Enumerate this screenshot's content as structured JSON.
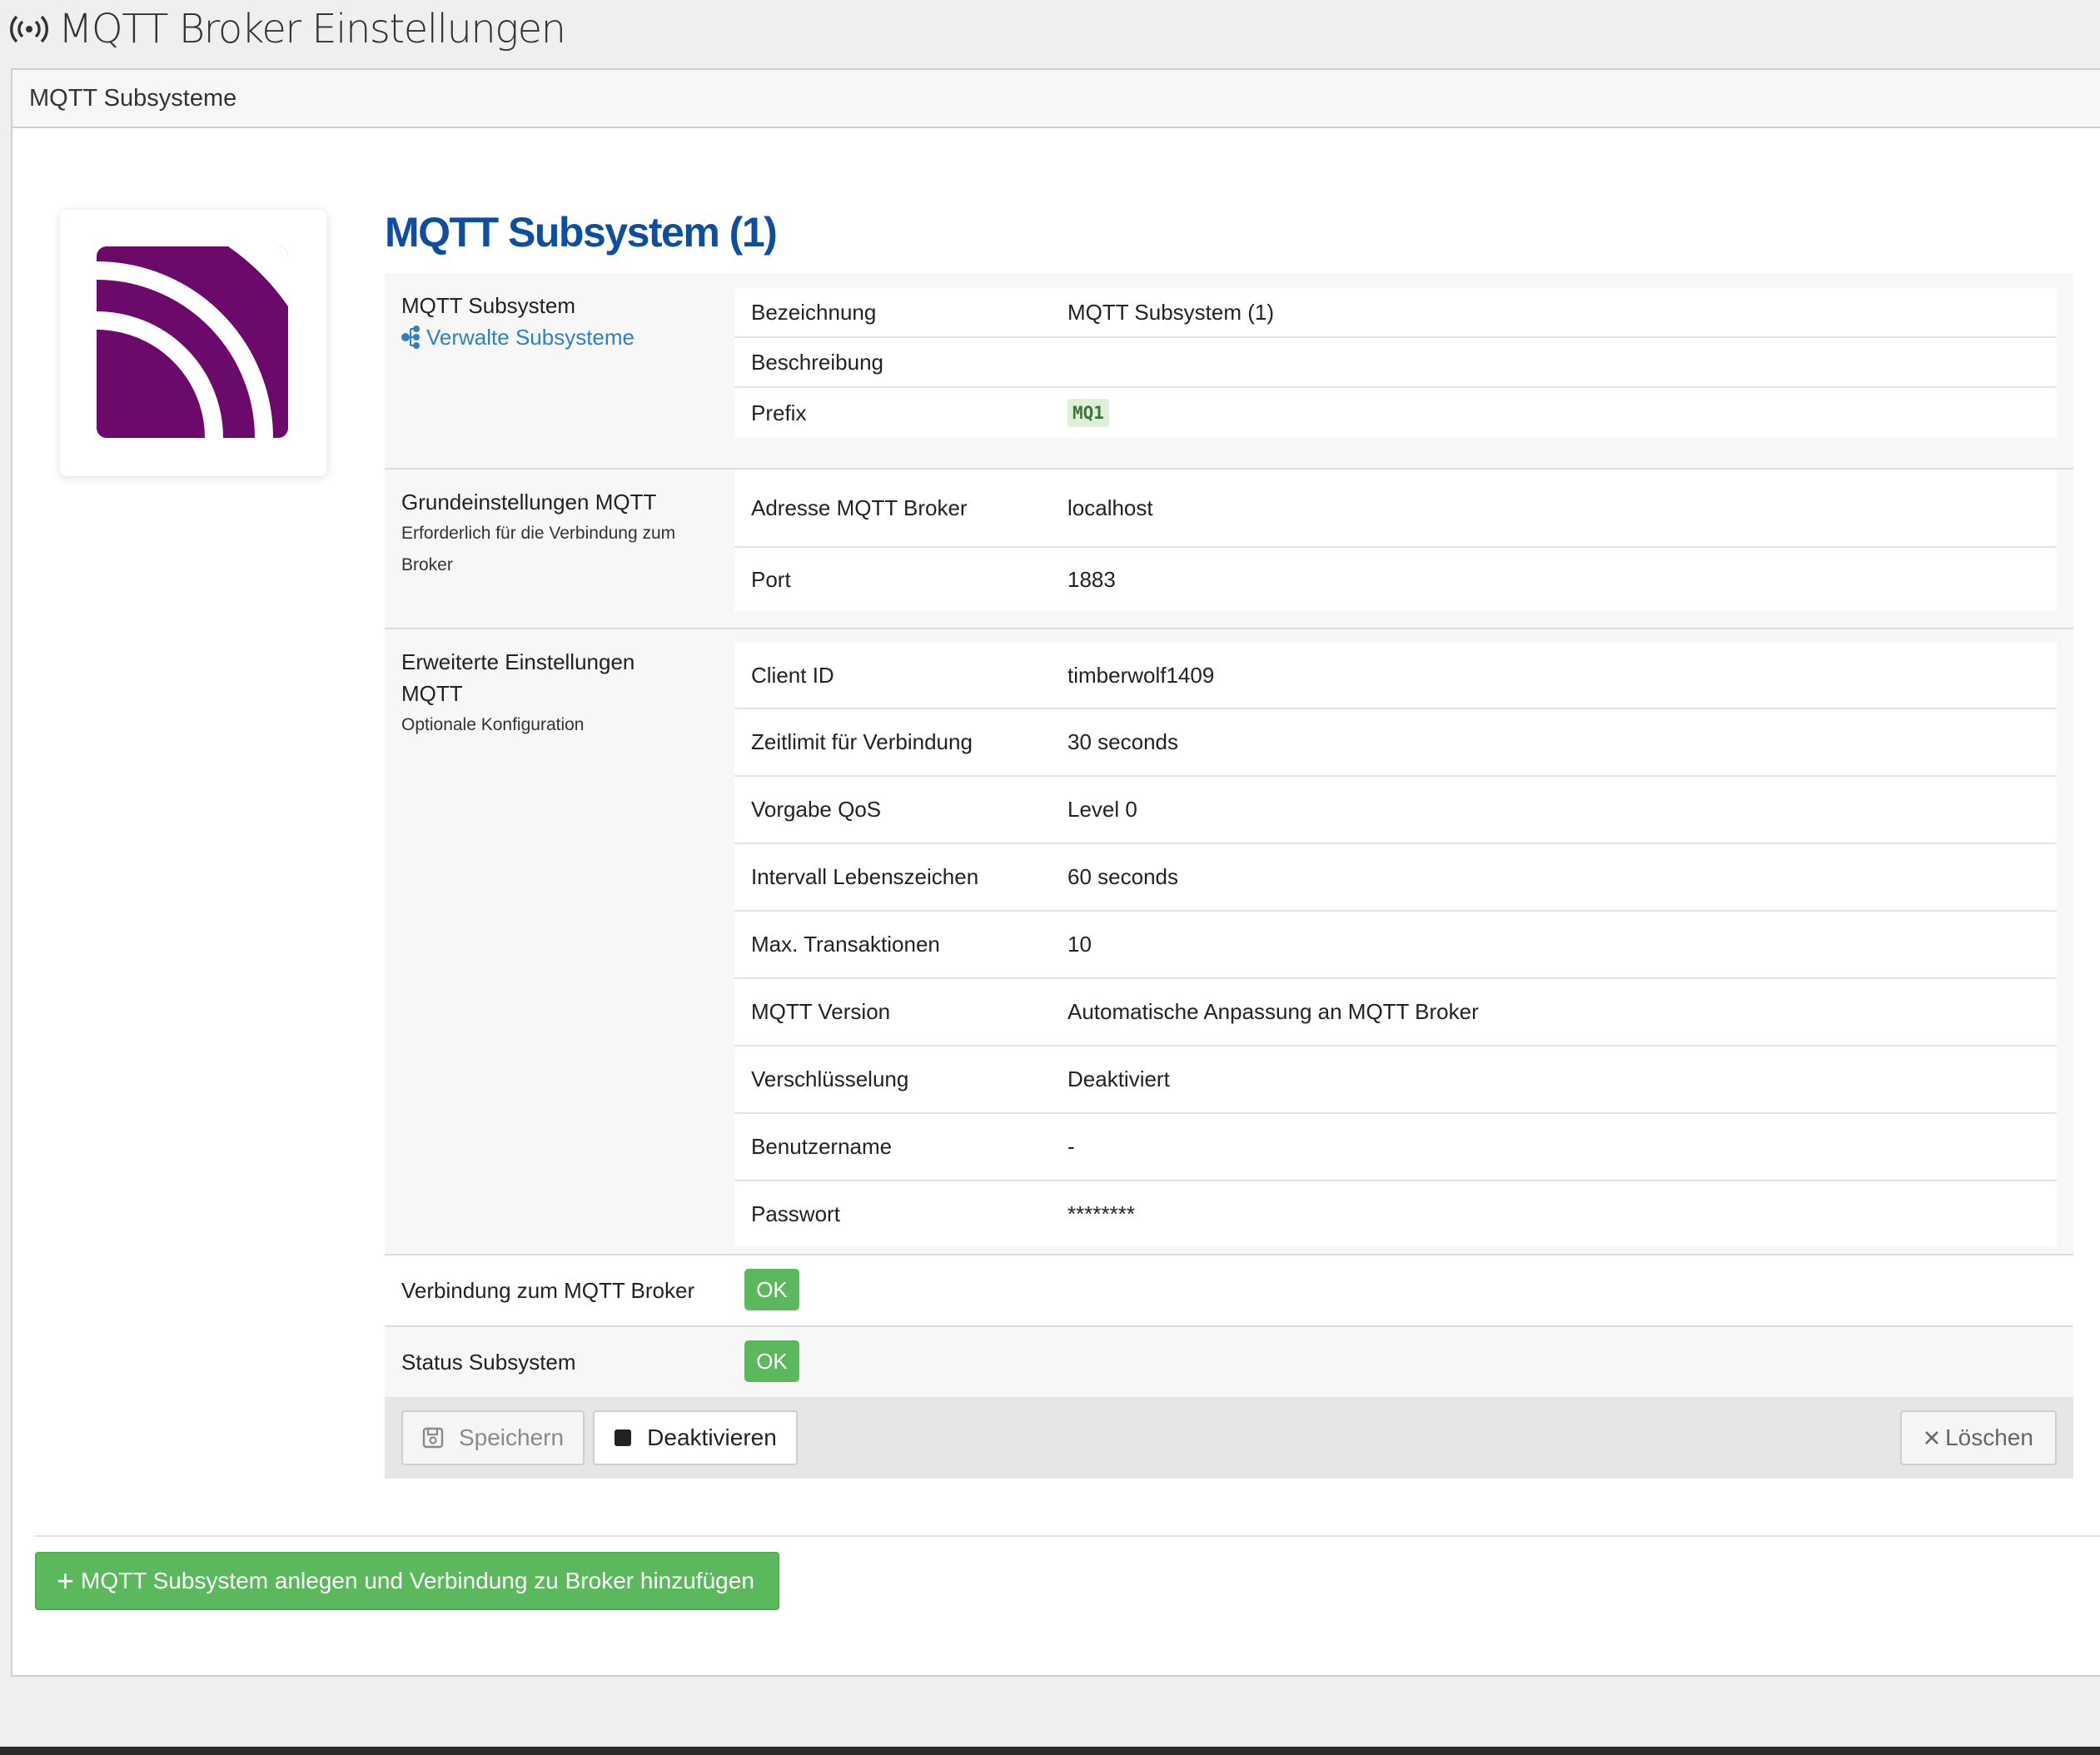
{
  "page": {
    "title": "MQTT Broker Einstellungen",
    "title_icon": "broadcast-icon"
  },
  "panel": {
    "heading": "MQTT Subsysteme"
  },
  "logo": {
    "icon": "mqtt-logo",
    "color": "#6b0a6b"
  },
  "subsystem": {
    "title": "MQTT Subsystem (1)",
    "identity": {
      "label": "MQTT Subsystem",
      "manage_link": "Verwalte Subsysteme",
      "manage_icon": "sitemap-icon",
      "rows": [
        {
          "label": "Bezeichnung",
          "value": "MQTT Subsystem (1)"
        },
        {
          "label": "Beschreibung",
          "value": ""
        },
        {
          "label": "Prefix",
          "value": "MQ1"
        }
      ]
    },
    "basic": {
      "title": "Grundeinstellungen MQTT",
      "subtitle": "Erforderlich für die Verbindung zum Broker",
      "rows": [
        {
          "label": "Adresse MQTT Broker",
          "value": "localhost"
        },
        {
          "label": "Port",
          "value": "1883"
        }
      ]
    },
    "advanced": {
      "title": "Erweiterte Einstellungen MQTT",
      "subtitle": "Optionale Konfiguration",
      "rows": [
        {
          "label": "Client ID",
          "value": "timberwolf1409"
        },
        {
          "label": "Zeitlimit für Verbindung",
          "value": "30 seconds"
        },
        {
          "label": "Vorgabe QoS",
          "value": "Level 0"
        },
        {
          "label": "Intervall Lebenszeichen",
          "value": "60 seconds"
        },
        {
          "label": "Max. Transaktionen",
          "value": "10"
        },
        {
          "label": "MQTT Version",
          "value": "Automatische Anpassung an MQTT Broker"
        },
        {
          "label": "Verschlüsselung",
          "value": "Deaktiviert"
        },
        {
          "label": "Benutzername",
          "value": "-"
        },
        {
          "label": "Passwort",
          "value": "********"
        }
      ]
    },
    "connection": {
      "label": "Verbindung zum MQTT Broker",
      "status": "OK"
    },
    "status": {
      "label": "Status Subsystem",
      "status": "OK"
    },
    "buttons": {
      "save": "Speichern",
      "deactivate": "Deaktivieren",
      "delete": "Löschen"
    }
  },
  "add_button": "MQTT Subsystem anlegen und Verbindung zu Broker hinzufügen",
  "colors": {
    "title_blue": "#0d4ea3",
    "link_blue": "#2e7fc9",
    "success_green": "#5cb85c",
    "logo_purple": "#6b0a6b"
  }
}
